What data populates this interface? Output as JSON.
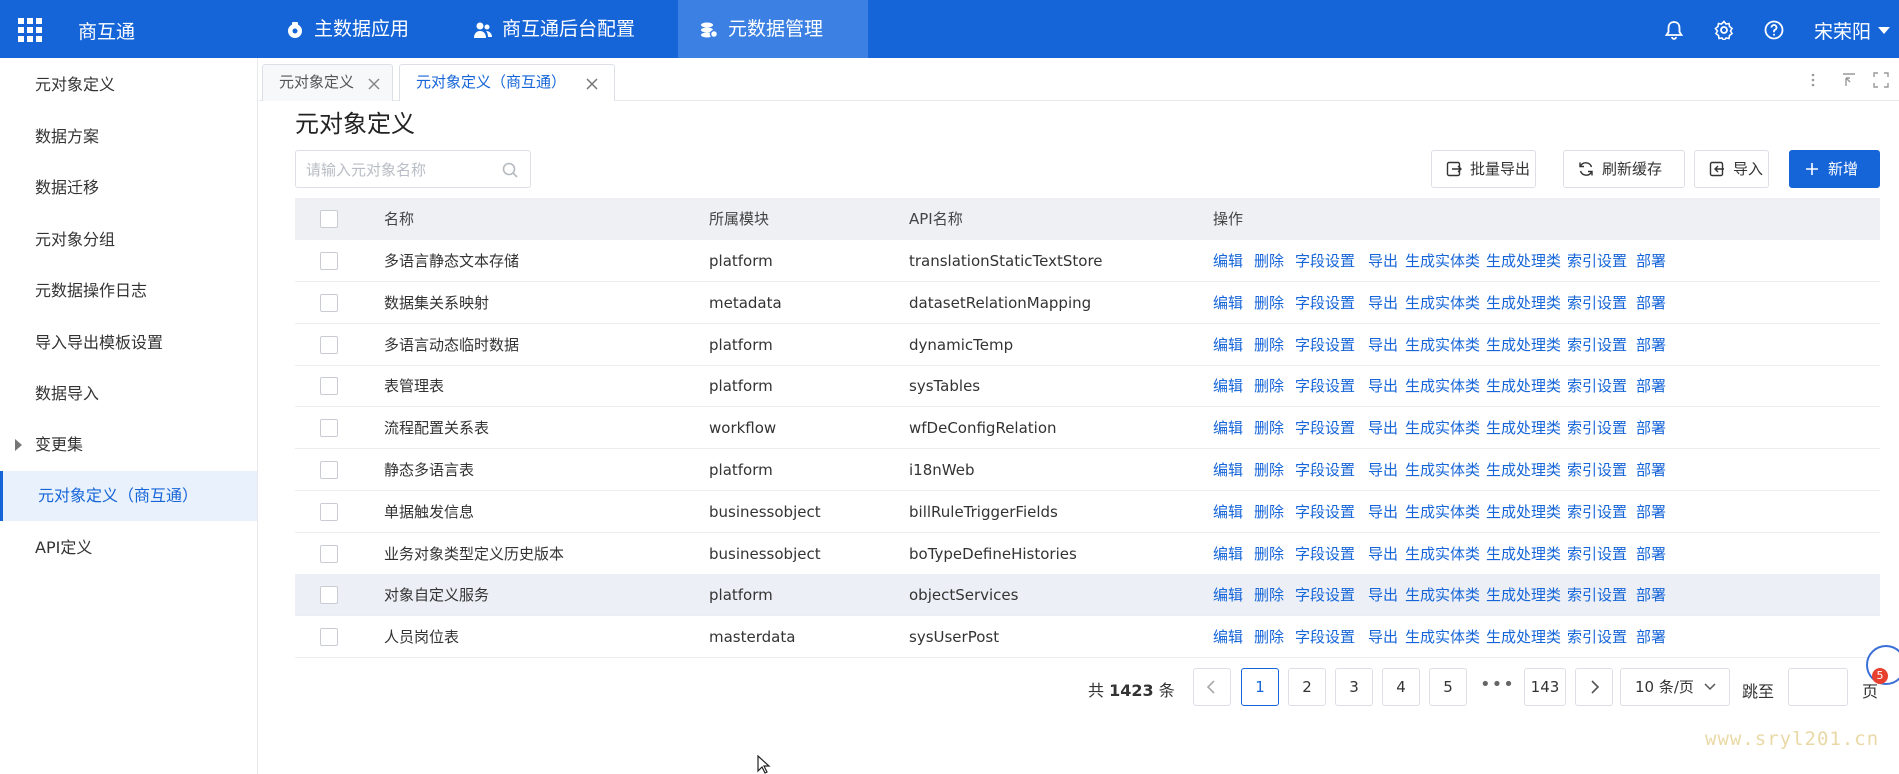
{
  "topbar": {
    "brand": "商互通",
    "tabs": [
      {
        "label": "主数据应用"
      },
      {
        "label": "商互通后台配置"
      },
      {
        "label": "元数据管理"
      }
    ],
    "user": "宋荣阳"
  },
  "sidebar": {
    "items": [
      {
        "label": "元对象定义"
      },
      {
        "label": "数据方案"
      },
      {
        "label": "数据迁移"
      },
      {
        "label": "元对象分组"
      },
      {
        "label": "元数据操作日志"
      },
      {
        "label": "导入导出模板设置"
      },
      {
        "label": "数据导入"
      },
      {
        "label": "变更集"
      },
      {
        "label": "元对象定义（商互通）"
      },
      {
        "label": "API定义"
      }
    ]
  },
  "tabstrip": {
    "tabs": [
      {
        "label": "元对象定义"
      },
      {
        "label": "元对象定义（商互通）"
      }
    ]
  },
  "main": {
    "title": "元对象定义",
    "search_placeholder": "请输入元对象名称",
    "buttons": {
      "batch_export": "批量导出",
      "refresh_cache": "刷新缓存",
      "import": "导入",
      "add": "新增"
    }
  },
  "table": {
    "columns": {
      "name": "名称",
      "module": "所属模块",
      "api": "API名称",
      "ops": "操作"
    },
    "ops": [
      "编辑",
      "删除",
      "字段设置",
      "导出",
      "生成实体类",
      "生成处理类",
      "索引设置",
      "部署"
    ],
    "rows": [
      {
        "name": "多语言静态文本存储",
        "module": "platform",
        "api": "translationStaticTextStore"
      },
      {
        "name": "数据集关系映射",
        "module": "metadata",
        "api": "datasetRelationMapping"
      },
      {
        "name": "多语言动态临时数据",
        "module": "platform",
        "api": "dynamicTemp"
      },
      {
        "name": "表管理表",
        "module": "platform",
        "api": "sysTables"
      },
      {
        "name": "流程配置关系表",
        "module": "workflow",
        "api": "wfDeConfigRelation"
      },
      {
        "name": "静态多语言表",
        "module": "platform",
        "api": "i18nWeb"
      },
      {
        "name": "单据触发信息",
        "module": "businessobject",
        "api": "billRuleTriggerFields"
      },
      {
        "name": "业务对象类型定义历史版本",
        "module": "businessobject",
        "api": "boTypeDefineHistories"
      },
      {
        "name": "对象自定义服务",
        "module": "platform",
        "api": "objectServices"
      },
      {
        "name": "人员岗位表",
        "module": "masterdata",
        "api": "sysUserPost"
      }
    ]
  },
  "pagination": {
    "total_prefix": "共",
    "total": "1423",
    "total_suffix": "条",
    "pages": [
      "1",
      "2",
      "3",
      "4",
      "5"
    ],
    "ellipsis": "•••",
    "last_page": "143",
    "current_page": "1",
    "page_size": "10 条/页",
    "jump_label": "跳至",
    "jump_suffix": "页"
  },
  "floating": {
    "badge": "5"
  },
  "watermark": "www.sryl201.cn",
  "colors": {
    "primary": "#1665d8",
    "topbar": "#1665d8",
    "link": "#1665d8",
    "header_bg": "#eef0f4"
  }
}
